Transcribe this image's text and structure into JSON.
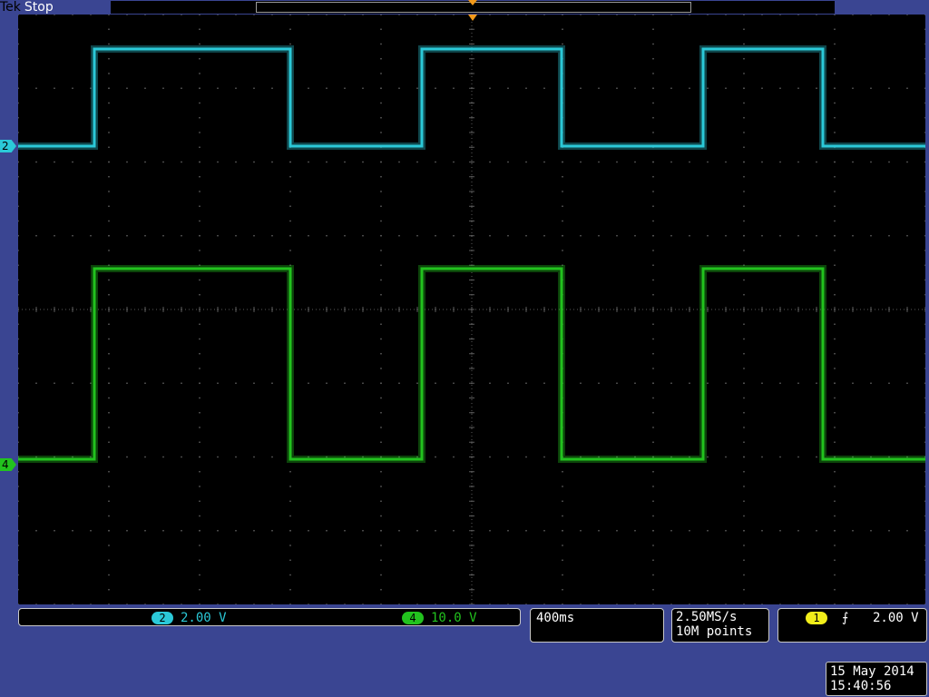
{
  "header": {
    "brand": "Tek",
    "acq_state": "Stop"
  },
  "channels": [
    {
      "id": "2",
      "scale": "2.00 V",
      "color": "#2bc9d8"
    },
    {
      "id": "4",
      "scale": "10.0 V",
      "color": "#22c21e"
    }
  ],
  "trigger": {
    "source": "1",
    "slope": "rising-edge-icon",
    "slope_glyph": "⨍",
    "level": "2.00 V",
    "color": "#f2ee1a"
  },
  "timebase": {
    "scale": "400ms",
    "sample_rate": "2.50MS/s",
    "record_length": "10M points"
  },
  "datetime": {
    "date": "15 May 2014",
    "time": "15:40:56"
  },
  "colors": {
    "background_frame": "#3a4592",
    "trigger_marker": "#f39a1a",
    "grid": "#5a5a5a"
  }
}
